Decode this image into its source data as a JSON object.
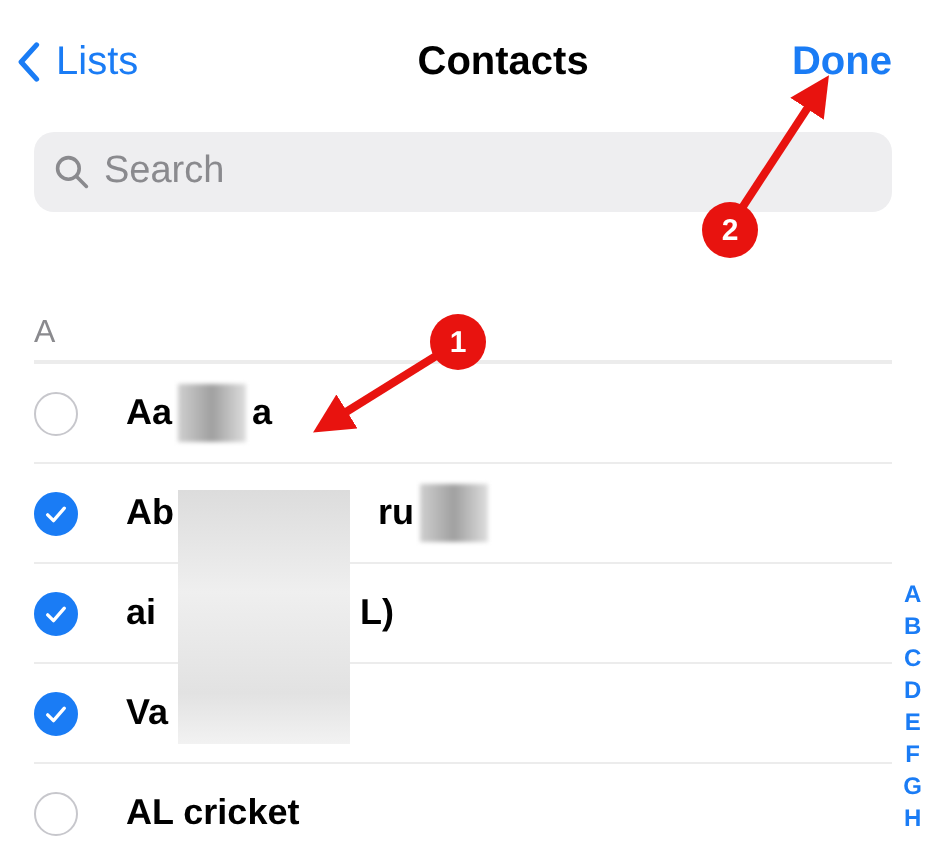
{
  "nav": {
    "back": "Lists",
    "title": "Contacts",
    "action": "Done"
  },
  "search": {
    "placeholder": "Search"
  },
  "section": "A",
  "contacts": [
    {
      "checked": false,
      "parts": [
        {
          "kind": "text",
          "text": "Aa"
        },
        {
          "kind": "blur"
        },
        {
          "kind": "text",
          "text": "a"
        }
      ]
    },
    {
      "checked": true,
      "parts": [
        {
          "kind": "text",
          "text": "Ab"
        },
        {
          "kind": "hidden"
        },
        {
          "kind": "text",
          "text": "ru"
        },
        {
          "kind": "blur"
        }
      ]
    },
    {
      "checked": true,
      "parts": [
        {
          "kind": "text",
          "text": "ai"
        },
        {
          "kind": "hidden"
        },
        {
          "kind": "text",
          "text": "L)"
        }
      ]
    },
    {
      "checked": true,
      "parts": [
        {
          "kind": "text",
          "text": "Va"
        },
        {
          "kind": "hidden"
        }
      ]
    },
    {
      "checked": false,
      "parts": [
        {
          "kind": "text",
          "text": "AL cricket"
        }
      ]
    }
  ],
  "index": [
    "A",
    "B",
    "C",
    "D",
    "E",
    "F",
    "G",
    "H"
  ],
  "annotations": [
    {
      "label": "1"
    },
    {
      "label": "2"
    }
  ]
}
